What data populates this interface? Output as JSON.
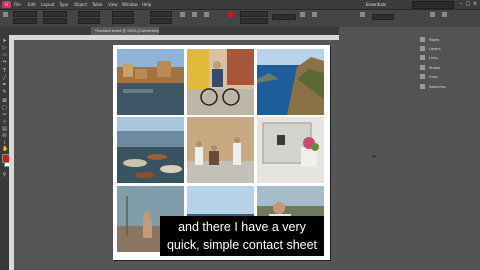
{
  "app": {
    "badge": "Id"
  },
  "menu": {
    "items": [
      "File",
      "Edit",
      "Layout",
      "Type",
      "Object",
      "Table",
      "View",
      "Window",
      "Help"
    ]
  },
  "workspace": {
    "label": "Essentials"
  },
  "document": {
    "tab_title": "*Contact sheet @ 100% [Converted]"
  },
  "tools": {
    "icons": [
      "selection-icon",
      "direct-selection-icon",
      "page-icon",
      "gap-icon",
      "type-icon",
      "line-icon",
      "pen-icon",
      "pencil-icon",
      "rectangle-frame-icon",
      "rectangle-icon",
      "scissors-icon",
      "free-transform-icon",
      "gradient-icon",
      "note-icon",
      "eyedropper-icon",
      "hand-icon",
      "zoom-icon"
    ],
    "fill_color": "#d0191f",
    "stroke_color": "#ffffff"
  },
  "panels": {
    "side": [
      "Pages",
      "Layers",
      "Links",
      "Stroke",
      "Color",
      "Swatches"
    ]
  },
  "photos": [
    "harbor-town",
    "man-with-bicycle",
    "coastal-cliff",
    "boats-on-beach",
    "people-by-wall",
    "door-with-flowers",
    "man-on-boat-deck",
    "sea-horizon",
    "smiling-man"
  ],
  "caption": {
    "line1": "and there I have a very",
    "line2": "quick, simple contact sheet"
  },
  "colors": {
    "accent": "#c8336a",
    "fill": "#d0191f"
  }
}
